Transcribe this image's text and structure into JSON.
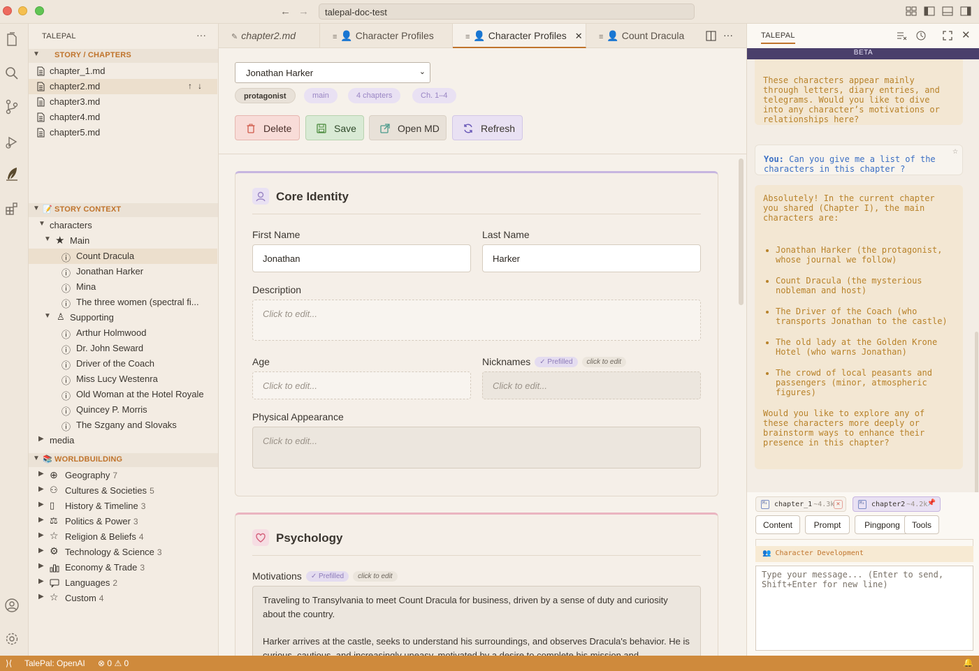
{
  "window": {
    "address": "talepal-doc-test"
  },
  "sidebar": {
    "title": "TALEPAL",
    "story_section": "STORY / CHAPTERS",
    "chapters": [
      "chapter_1.md",
      "chapter2.md",
      "chapter3.md",
      "chapter4.md",
      "chapter5.md"
    ],
    "context_section": "STORY CONTEXT",
    "characters_folder": "characters",
    "main_group": "Main",
    "main_chars": [
      "Count Dracula",
      "Jonathan Harker",
      "Mina",
      "The three women (spectral fi..."
    ],
    "supporting_group": "Supporting",
    "supporting_chars": [
      "Arthur Holmwood",
      "Dr. John Seward",
      "Driver of the Coach",
      "Miss Lucy Westenra",
      "Old Woman at the Hotel Royale",
      "Quincey P. Morris",
      "The Szgany and Slovaks"
    ],
    "media_folder": "media",
    "world_section": "WORLDBUILDING",
    "world_items": [
      {
        "label": "Geography",
        "count": "7",
        "icon": "globe-icon"
      },
      {
        "label": "Cultures & Societies",
        "count": "5",
        "icon": "people-icon"
      },
      {
        "label": "History & Timeline",
        "count": "3",
        "icon": "book-icon"
      },
      {
        "label": "Politics & Power",
        "count": "3",
        "icon": "scales-icon"
      },
      {
        "label": "Religion & Beliefs",
        "count": "4",
        "icon": "star-icon"
      },
      {
        "label": "Technology & Science",
        "count": "3",
        "icon": "gear-icon"
      },
      {
        "label": "Economy & Trade",
        "count": "3",
        "icon": "chart-icon"
      },
      {
        "label": "Languages",
        "count": "2",
        "icon": "chat-icon"
      },
      {
        "label": "Custom",
        "count": "4",
        "icon": "star-icon"
      }
    ]
  },
  "tabs": [
    {
      "label": "chapter2.md",
      "icon": "pin-icon"
    },
    {
      "label": "Character Profiles",
      "icon": "doc-icon"
    },
    {
      "label": "Character Profiles",
      "icon": "doc-icon"
    },
    {
      "label": "Count Dracula",
      "icon": "doc-icon"
    }
  ],
  "editor": {
    "selected_character": "Jonathan Harker",
    "chips": [
      "protagonist",
      "main",
      "4 chapters",
      "Ch. 1–4"
    ],
    "buttons": {
      "delete": "Delete",
      "save": "Save",
      "open": "Open MD",
      "refresh": "Refresh"
    },
    "core": {
      "title": "Core Identity",
      "first_name_label": "First Name",
      "first_name": "Jonathan",
      "last_name_label": "Last Name",
      "last_name": "Harker",
      "description_label": "Description",
      "age_label": "Age",
      "nicknames_label": "Nicknames",
      "physical_label": "Physical Appearance",
      "placeholder": "Click to edit...",
      "prefilled": "✓ Prefilled",
      "click_to_edit": "click to edit"
    },
    "psych": {
      "title": "Psychology",
      "motivations_label": "Motivations",
      "motivations_p1": "Traveling to Transylvania to meet Count Dracula for business, driven by a sense of duty and curiosity about the country.",
      "motivations_p2": "Harker arrives at the castle, seeks to understand his surroundings, and observes Dracula's behavior. He is curious, cautious, and increasingly uneasy, motivated by a desire to complete his mission and"
    }
  },
  "chat": {
    "title": "TALEPAL",
    "beta": "BETA",
    "msg1": "These characters appear mainly through letters, diary entries, and telegrams. Would you like to dive into any character’s motivations or relationships here?",
    "user_prefix": "You:",
    "user_msg": "Can you give me a list of the characters in this chapter ?",
    "msg2_intro": "Absolutely! In the current chapter you shared (Chapter I), the main characters are:",
    "msg2_list": [
      "Jonathan Harker (the protagonist, whose journal we follow)",
      "Count Dracula (the mysterious nobleman and host)",
      "The Driver of the Coach (who transports Jonathan to the castle)",
      "The old lady at the Golden Krone Hotel (who warns Jonathan)",
      "The crowd of local peasants and passengers (minor, atmospheric figures)"
    ],
    "msg2_outro": "Would you like to explore any of these characters more deeply or brainstorm ways to enhance their presence in this chapter?",
    "files": [
      {
        "name": "chapter_1",
        "size": "~4.3k"
      },
      {
        "name": "chapter2",
        "size": "~4.2k"
      }
    ],
    "mode_buttons": [
      "Content",
      "Prompt",
      "Pingpong",
      "Tools"
    ],
    "context_label": "👥 Character Development",
    "input_placeholder": "Type your message... (Enter to send, Shift+Enter for new line)"
  },
  "statusbar": {
    "name": "TalePal: OpenAI",
    "errors": "0",
    "warnings": "0"
  },
  "colors": {
    "accent": "#c0742c",
    "statusbar": "#cf8a3c",
    "beta": "#4a3f6b"
  }
}
